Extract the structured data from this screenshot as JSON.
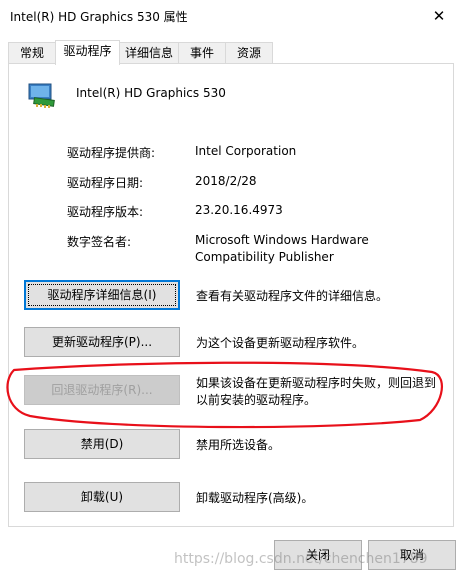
{
  "window": {
    "title": "Intel(R) HD Graphics 530 属性",
    "close_glyph": "✕"
  },
  "tabs": [
    {
      "label": "常规",
      "active": false
    },
    {
      "label": "驱动程序",
      "active": true
    },
    {
      "label": "详细信息",
      "active": false
    },
    {
      "label": "事件",
      "active": false
    },
    {
      "label": "资源",
      "active": false
    }
  ],
  "device": {
    "icon": "display-adapter-icon",
    "name": "Intel(R) HD Graphics 530"
  },
  "properties": [
    {
      "label": "驱动程序提供商:",
      "value": "Intel Corporation"
    },
    {
      "label": "驱动程序日期:",
      "value": "2018/2/28"
    },
    {
      "label": "驱动程序版本:",
      "value": "23.20.16.4973"
    },
    {
      "label": "数字签名者:",
      "value_line1": "Microsoft Windows Hardware",
      "value_line2": "Compatibility Publisher"
    }
  ],
  "actions": [
    {
      "label": "驱动程序详细信息(I)",
      "description": "查看有关驱动程序文件的详细信息。",
      "enabled": true,
      "focused": true
    },
    {
      "label": "更新驱动程序(P)...",
      "description": "为这个设备更新驱动程序软件。",
      "enabled": true,
      "focused": false
    },
    {
      "label": "回退驱动程序(R)...",
      "description_line1": "如果该设备在更新驱动程序时失败，则回退到",
      "description_line2": "以前安装的驱动程序。",
      "enabled": false,
      "focused": false
    },
    {
      "label": "禁用(D)",
      "description": "禁用所选设备。",
      "enabled": true,
      "focused": false
    },
    {
      "label": "卸载(U)",
      "description": "卸载驱动程序(高级)。",
      "enabled": true,
      "focused": false
    }
  ],
  "footer": {
    "ok_label": "关闭",
    "cancel_label": "取消"
  },
  "watermark": "https://blog.csdn.net/chenchen1789",
  "colors": {
    "annotation_red": "#e8101a",
    "focus_blue": "#0078d7"
  }
}
